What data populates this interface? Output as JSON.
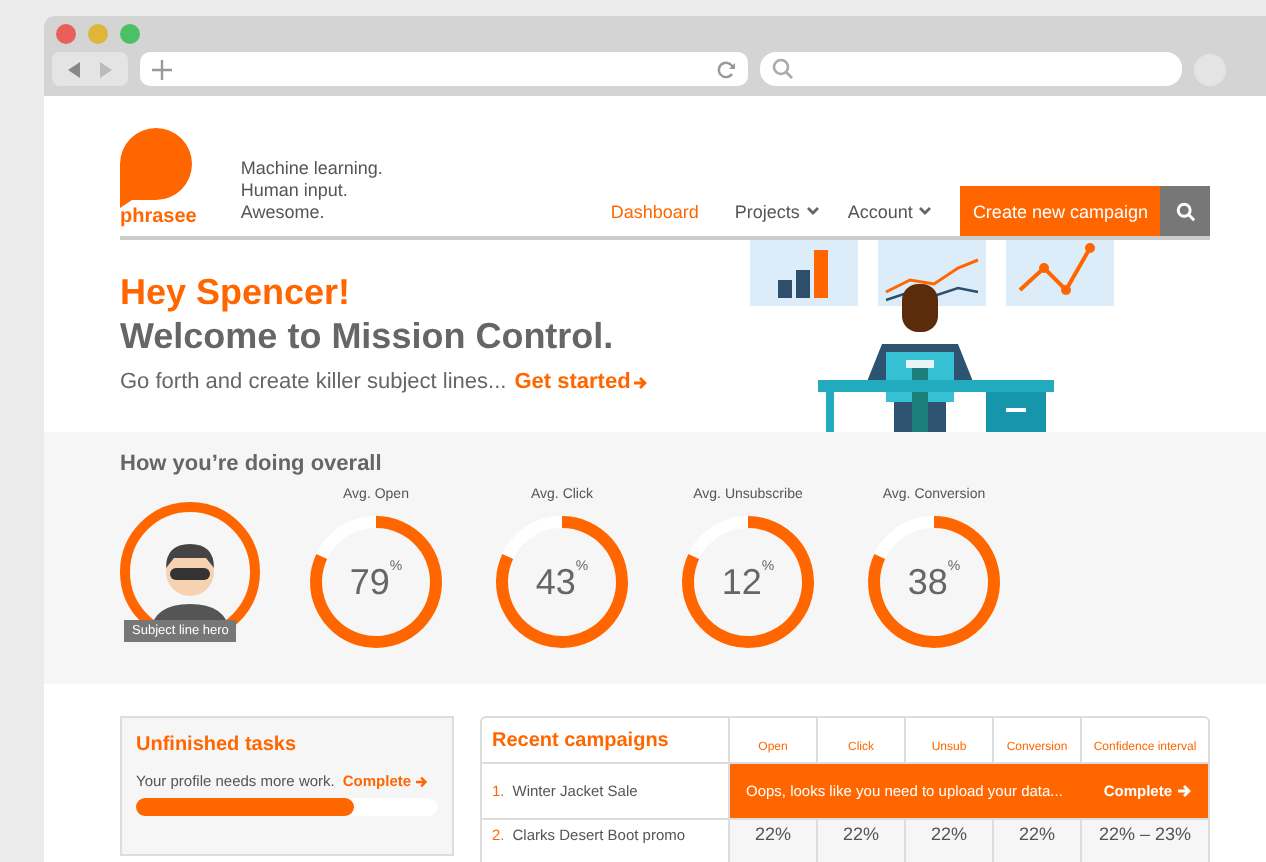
{
  "brand": {
    "name": "phrasee",
    "tagline": [
      "Machine learning.",
      "Human input.",
      "Awesome."
    ]
  },
  "nav": [
    {
      "label": "Dashboard",
      "selected": true,
      "kind": "link"
    },
    {
      "label": "Projects",
      "selected": false,
      "kind": "menu"
    },
    {
      "label": "Account",
      "selected": false,
      "kind": "menu"
    }
  ],
  "create_button": "Create new campaign",
  "hero": {
    "greeting": "Hey Spencer!",
    "title": "Welcome to Mission Control.",
    "subtitle": "Go forth and create killer subject lines...",
    "link": "Get started"
  },
  "overall": {
    "title": "How you’re doing overall",
    "badge": "Subject line hero",
    "metrics": [
      {
        "label": "Avg. Open",
        "value": "79",
        "unit": "%",
        "level": 0.82
      },
      {
        "label": "Avg. Click",
        "value": "43",
        "unit": "%",
        "level": 0.82
      },
      {
        "label": "Avg. Unsubscribe",
        "value": "12",
        "unit": "%",
        "level": 0.82
      },
      {
        "label": "Avg. Conversion",
        "value": "38",
        "unit": "%",
        "level": 0.82
      }
    ]
  },
  "tasks": {
    "title": "Unfinished tasks",
    "text": "Your profile needs more work.",
    "link": "Complete",
    "level": 0.72
  },
  "campaigns": {
    "title": "Recent campaigns",
    "columns": [
      "Open",
      "Click",
      "Unsub",
      "Conversion",
      "Confidence interval"
    ],
    "rows": [
      {
        "number": "1.",
        "name": "Winter Jacket Sale",
        "kind": "notice",
        "notice": "Oops, looks like you need to upload your data...",
        "action": "Complete"
      },
      {
        "number": "2.",
        "name": "Clarks Desert Boot promo",
        "kind": "values",
        "values": [
          "22%",
          "22%",
          "22%",
          "22%",
          "22% – 23%"
        ]
      }
    ]
  }
}
